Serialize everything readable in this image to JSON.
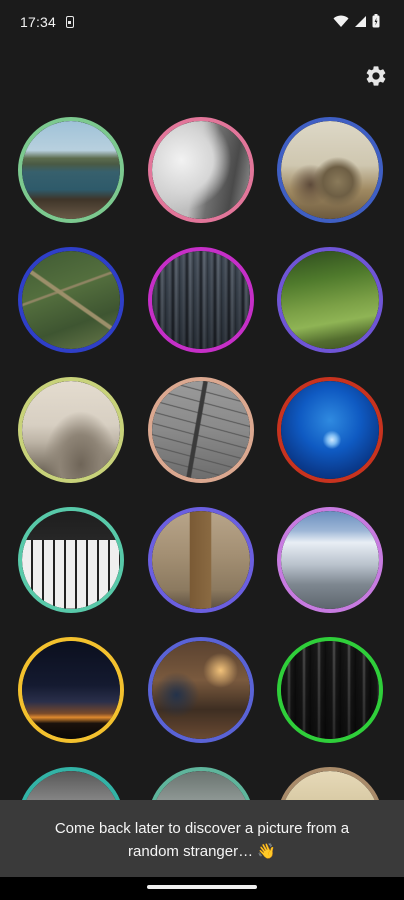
{
  "status_bar": {
    "time": "17:34",
    "icons": [
      "sim-card-icon",
      "wifi-icon",
      "signal-icon",
      "battery-icon"
    ]
  },
  "toolbar": {
    "settings_icon": "gear-icon"
  },
  "photos": [
    {
      "name": "coastal-cliffs-photo",
      "border": "#7cc98f"
    },
    {
      "name": "misty-mountain-photo",
      "border": "#e2769a"
    },
    {
      "name": "teapot-photo",
      "border": "#3f5fc4"
    },
    {
      "name": "aerial-fields-photo",
      "border": "#2f3fc8"
    },
    {
      "name": "crowd-market-photo",
      "border": "#c62fc8"
    },
    {
      "name": "hillside-pasture-photo",
      "border": "#6f55d6"
    },
    {
      "name": "pebbles-sea-photo",
      "border": "#c8d27a"
    },
    {
      "name": "fence-fog-photo",
      "border": "#dba890"
    },
    {
      "name": "jellyfish-photo",
      "border": "#c8331f"
    },
    {
      "name": "piano-keys-photo",
      "border": "#58c9a9"
    },
    {
      "name": "old-door-photo",
      "border": "#6b5fe0"
    },
    {
      "name": "snowy-valley-photo",
      "border": "#c77be0"
    },
    {
      "name": "night-horizon-photo",
      "border": "#f3c12e"
    },
    {
      "name": "cafe-interior-photo",
      "border": "#5a63d6"
    },
    {
      "name": "forest-photo",
      "border": "#2fcf3a"
    },
    {
      "name": "partial-photo-1",
      "border": "#33b3a6"
    },
    {
      "name": "partial-photo-2",
      "border": "#5fb59c"
    },
    {
      "name": "partial-photo-3",
      "border": "#a98b6a"
    }
  ],
  "toast": {
    "message": "Come back later to discover a picture from a random stranger… 👋"
  }
}
